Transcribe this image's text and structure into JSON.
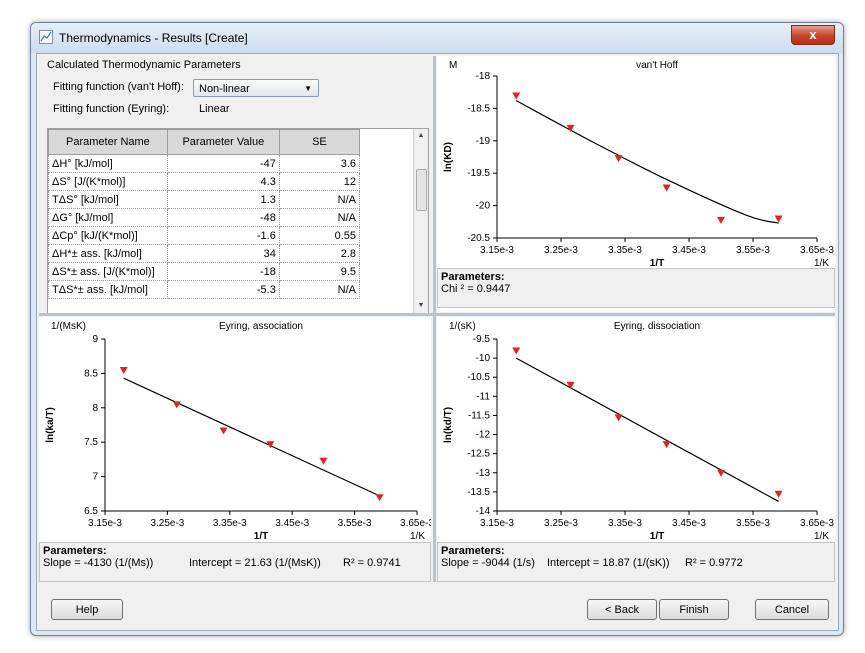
{
  "window": {
    "title": "Thermodynamics - Results  [Create]",
    "close_glyph": "x"
  },
  "params_panel": {
    "group_title": "Calculated Thermodynamic Parameters",
    "fit_vant_hoff_label": "Fitting function (van't Hoff):",
    "fit_vant_hoff_value": "Non-linear",
    "fit_eyring_label": "Fitting function (Eyring):",
    "fit_eyring_value": "Linear",
    "table": {
      "headers": [
        "Parameter Name",
        "Parameter Value",
        "SE"
      ],
      "rows": [
        [
          "ΔH° [kJ/mol]",
          "-47",
          "3.6"
        ],
        [
          "ΔS° [J/(K*mol)]",
          "4.3",
          "12"
        ],
        [
          "TΔS° [kJ/mol]",
          "1.3",
          "N/A"
        ],
        [
          "ΔG° [kJ/mol]",
          "-48",
          "N/A"
        ],
        [
          "ΔCp° [kJ/(K*mol)]",
          "-1.6",
          "0.55"
        ],
        [
          "ΔH*± ass. [kJ/mol]",
          "34",
          "2.8"
        ],
        [
          "ΔS*± ass. [J/(K*mol)]",
          "-18",
          "9.5"
        ],
        [
          "TΔS*± ass. [kJ/mol]",
          "-5.3",
          "N/A"
        ]
      ]
    }
  },
  "charts": {
    "vant_hoff": {
      "unit_label": "M",
      "title": "van't Hoff",
      "xlabel": "1/T",
      "xunit": "1/K",
      "ylabel": "ln(KD)",
      "params_title": "Parameters:",
      "params_line": "Chi ² = 0.9447"
    },
    "eyring_assoc": {
      "unit_label": "1/(MsK)",
      "title": "Eyring, association",
      "xlabel": "1/T",
      "xunit": "1/K",
      "ylabel": "ln(ka/T)",
      "params_title": "Parameters:",
      "slope": "Slope = -4130 (1/(Ms))",
      "intercept": "Intercept = 21.63 (1/(MsK))",
      "r2": "R² = 0.9741"
    },
    "eyring_dissoc": {
      "unit_label": "1/(sK)",
      "title": "Eyring, dissociation",
      "xlabel": "1/T",
      "xunit": "1/K",
      "ylabel": "ln(kd/T)",
      "params_title": "Parameters:",
      "slope": "Slope = -9044 (1/s)",
      "intercept": "Intercept = 18.87 (1/(sK))",
      "r2": "R² = 0.9772"
    }
  },
  "buttons": {
    "help": "Help",
    "back": "< Back",
    "finish": "Finish",
    "cancel": "Cancel"
  },
  "chart_data": [
    {
      "type": "scatter",
      "title": "van't Hoff",
      "xlabel": "1/T",
      "ylabel": "ln(KD)",
      "xlim": [
        0.00315,
        0.00365
      ],
      "ylim": [
        -20.5,
        -18
      ],
      "xticks": [
        "3.15e-3",
        "3.25e-3",
        "3.35e-3",
        "3.45e-3",
        "3.55e-3",
        "3.65e-3"
      ],
      "yticks": [
        "-18",
        "-18.5",
        "-19",
        "-19.5",
        "-20",
        "-20.5"
      ],
      "points": {
        "x": [
          0.00318,
          0.003265,
          0.00334,
          0.003415,
          0.0035,
          0.00359
        ],
        "y": [
          -18.3,
          -18.8,
          -19.27,
          -19.72,
          -20.22,
          -20.2
        ]
      },
      "fit": {
        "x": [
          0.00318,
          0.0033,
          0.00342,
          0.00354,
          0.00359
        ],
        "y": [
          -18.38,
          -19.02,
          -19.62,
          -20.15,
          -20.27
        ]
      }
    },
    {
      "type": "scatter",
      "title": "Eyring, association",
      "xlabel": "1/T",
      "ylabel": "ln(ka/T)",
      "xlim": [
        0.00315,
        0.00365
      ],
      "ylim": [
        6.5,
        9
      ],
      "xticks": [
        "3.15e-3",
        "3.25e-3",
        "3.35e-3",
        "3.45e-3",
        "3.55e-3",
        "3.65e-3"
      ],
      "yticks": [
        "9",
        "8.5",
        "8",
        "7.5",
        "7",
        "6.5"
      ],
      "points": {
        "x": [
          0.00318,
          0.003265,
          0.00334,
          0.003415,
          0.0035,
          0.00359
        ],
        "y": [
          8.55,
          8.05,
          7.67,
          7.47,
          7.23,
          6.7
        ]
      },
      "fit": {
        "x": [
          0.00318,
          0.00359
        ],
        "y": [
          8.43,
          6.72
        ]
      }
    },
    {
      "type": "scatter",
      "title": "Eyring, dissociation",
      "xlabel": "1/T",
      "ylabel": "ln(kd/T)",
      "xlim": [
        0.00315,
        0.00365
      ],
      "ylim": [
        -14,
        -9.5
      ],
      "xticks": [
        "3.15e-3",
        "3.25e-3",
        "3.35e-3",
        "3.45e-3",
        "3.55e-3",
        "3.65e-3"
      ],
      "yticks": [
        "-9.5",
        "-10",
        "-10.5",
        "-11",
        "-11.5",
        "-12",
        "-12.5",
        "-13",
        "-13.5",
        "-14"
      ],
      "points": {
        "x": [
          0.00318,
          0.003265,
          0.00334,
          0.003415,
          0.0035,
          0.00359
        ],
        "y": [
          -9.8,
          -10.7,
          -11.55,
          -12.25,
          -13.0,
          -13.55
        ]
      },
      "fit": {
        "x": [
          0.00318,
          0.00359
        ],
        "y": [
          -10.0,
          -13.75
        ]
      }
    }
  ]
}
